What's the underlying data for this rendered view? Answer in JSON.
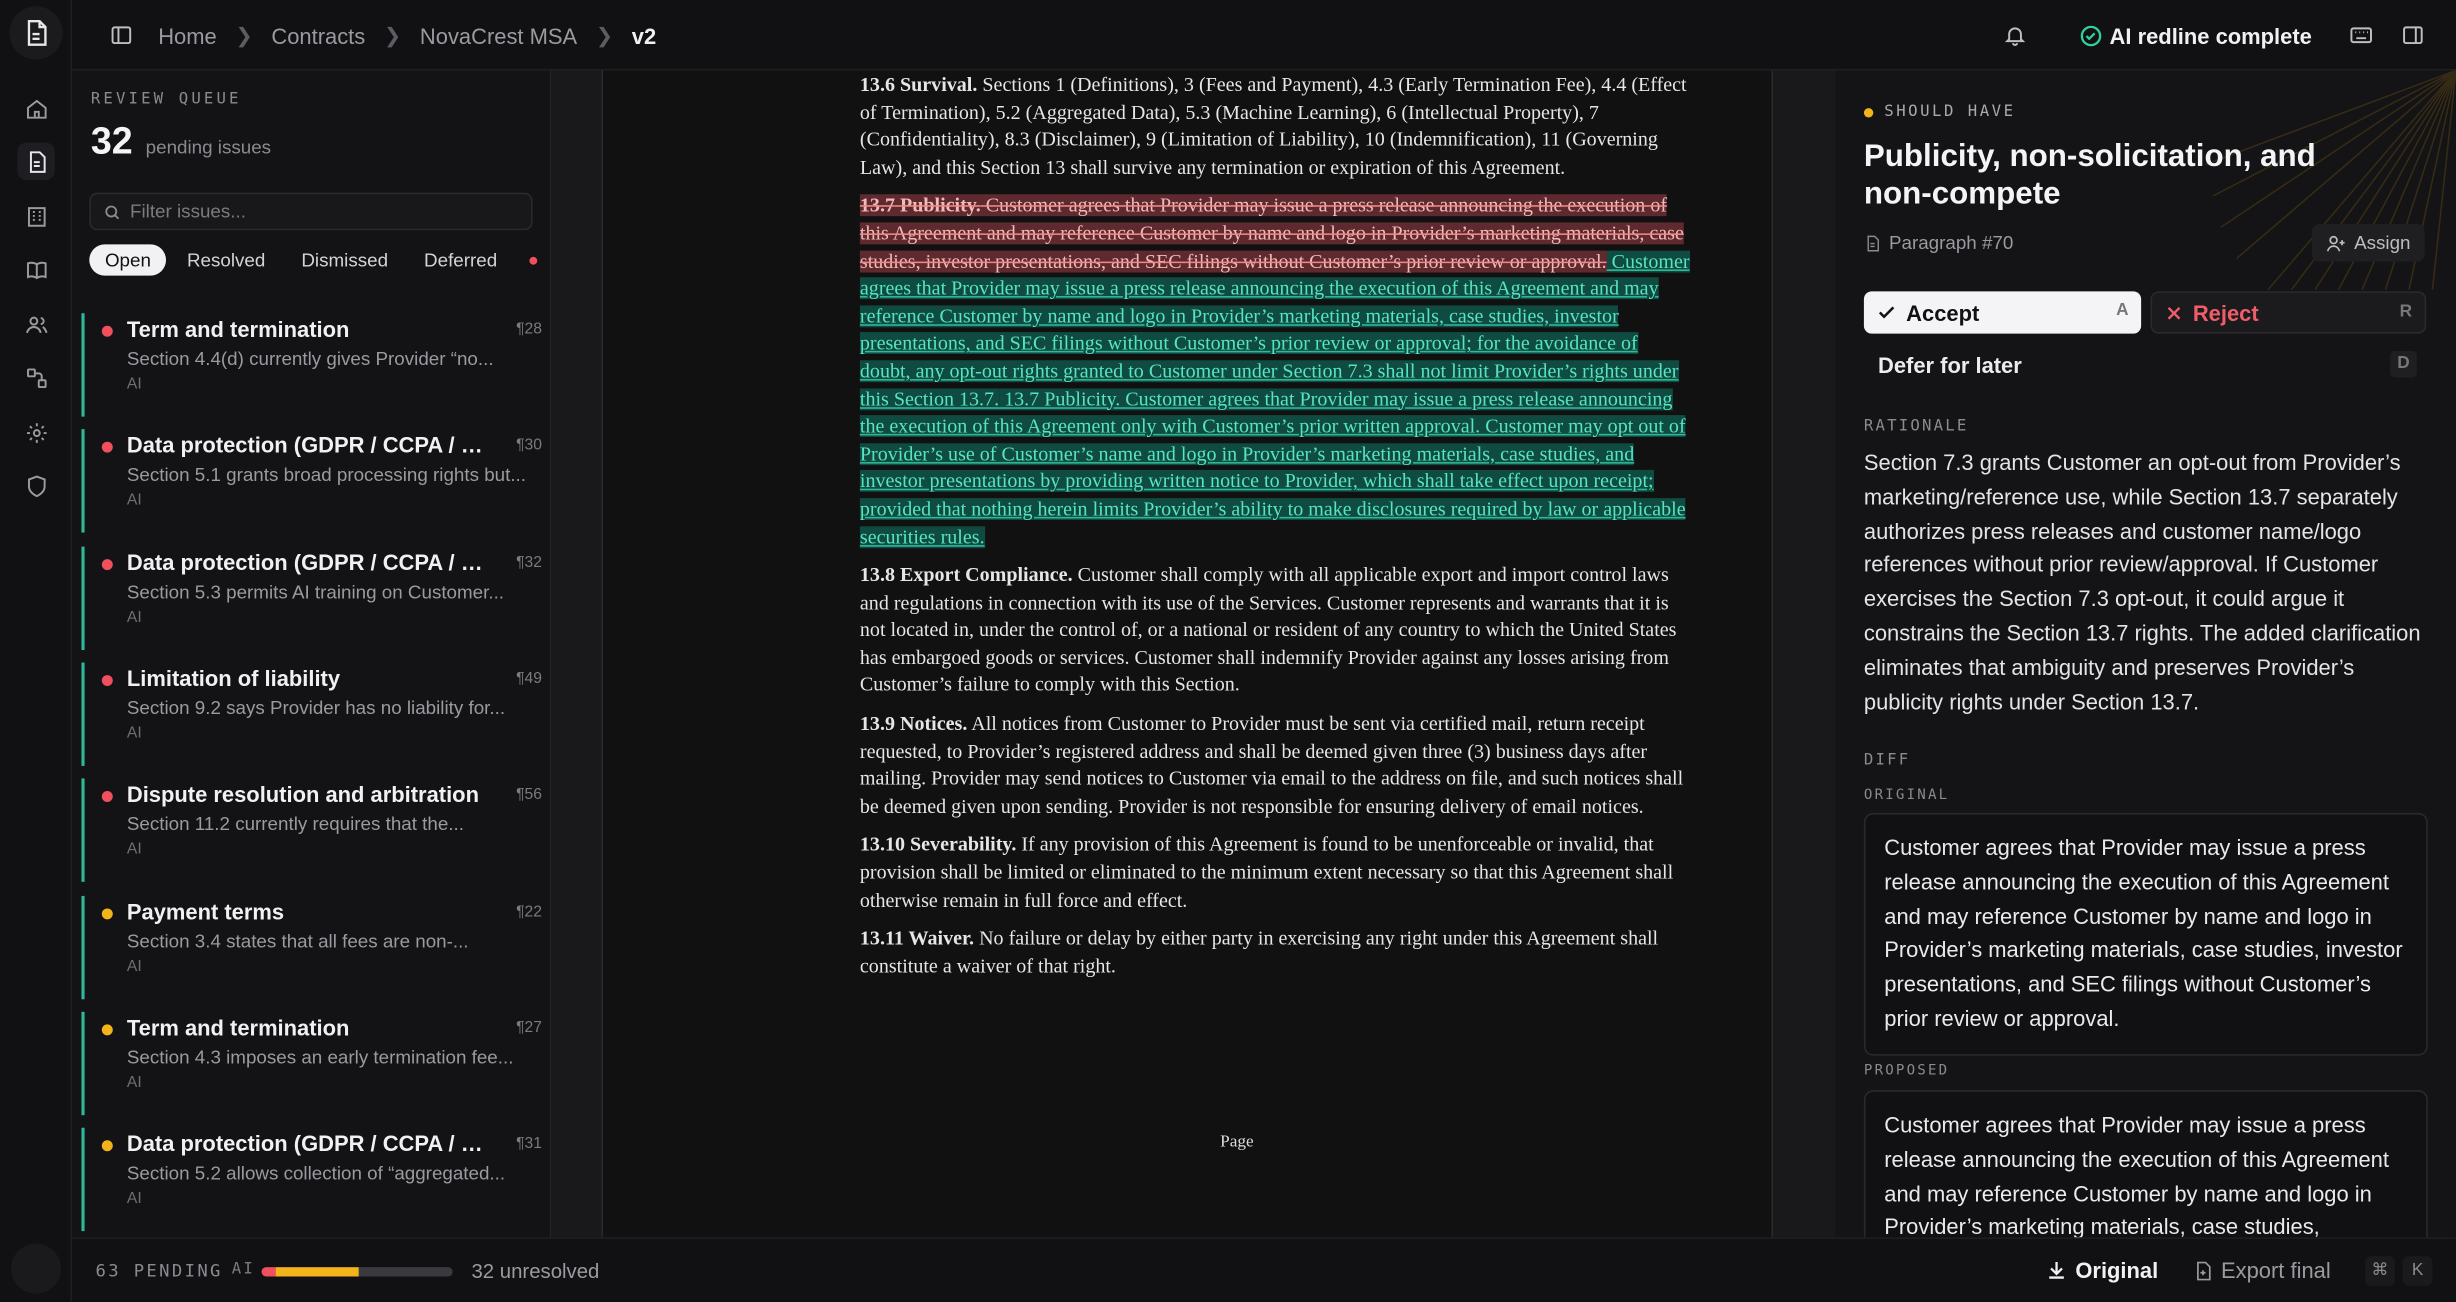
{
  "app": {
    "title": "NovaCrest MSA"
  },
  "breadcrumb": [
    "Home",
    "Contracts",
    "NovaCrest MSA",
    "v2"
  ],
  "topbar": {
    "status_label": "AI redline complete"
  },
  "review_queue": {
    "label": "REVIEW QUEUE",
    "count": "32",
    "count_label": "pending issues",
    "filter_placeholder": "Filter issues...",
    "tabs": [
      "Open",
      "Resolved",
      "Dismissed",
      "Deferred"
    ],
    "active_tab": "Open",
    "issues": [
      {
        "title": "Term and termination",
        "para": "¶28",
        "desc": "Section 4.4(d) currently gives Provider “no...",
        "tag": "AI",
        "severity": "must"
      },
      {
        "title": "Data protection (GDPR / CCPA / D...",
        "para": "¶30",
        "desc": "Section 5.1 grants broad processing rights but...",
        "tag": "AI",
        "severity": "must"
      },
      {
        "title": "Data protection (GDPR / CCPA / D...",
        "para": "¶32",
        "desc": "Section 5.3 permits AI training on Customer...",
        "tag": "AI",
        "severity": "must"
      },
      {
        "title": "Limitation of liability",
        "para": "¶49",
        "desc": "Section 9.2 says Provider has no liability for...",
        "tag": "AI",
        "severity": "must"
      },
      {
        "title": "Dispute resolution and arbitration",
        "para": "¶56",
        "desc": "Section 11.2 currently requires that the...",
        "tag": "AI",
        "severity": "must"
      },
      {
        "title": "Payment terms",
        "para": "¶22",
        "desc": "Section 3.4 states that all fees are non-...",
        "tag": "AI",
        "severity": "should"
      },
      {
        "title": "Term and termination",
        "para": "¶27",
        "desc": "Section 4.3 imposes an early termination fee...",
        "tag": "AI",
        "severity": "should"
      },
      {
        "title": "Data protection (GDPR / CCPA / D...",
        "para": "¶31",
        "desc": "Section 5.2 allows collection of “aggregated...",
        "tag": "AI",
        "severity": "should"
      }
    ]
  },
  "document": {
    "survival_head": "13.6 Survival.",
    "survival_body": " Sections 1 (Definitions), 3 (Fees and Payment), 4.3 (Early Termination Fee), 4.4 (Effect of Termination), 5.2 (Aggregated Data), 5.3 (Machine Learning), 6 (Intellectual Property), 7 (Confidentiality), 8.3 (Disclaimer), 9 (Limitation of Liability), 10 (Indemnification), 11 (Governing Law), and this Section 13 shall survive any termination or expiration of this Agreement.",
    "publicity_head": "13.7 Publicity.",
    "publicity_deleted": " Customer agrees that Provider may issue a press release announcing the execution of this Agreement and may reference Customer by name and logo in Provider’s marketing materials, case studies, investor presentations, and SEC filings without Customer’s prior review or approval.",
    "publicity_inserted_1": " Customer agrees that Provider may issue a press release announcing the execution of this Agreement and may reference Customer by name and logo in Provider’s marketing materials, case studies, investor presentations, and SEC filings without Customer’s prior review or approval; for the avoidance of doubt, any opt-out rights granted to Customer under Section 7.3 shall not limit Provider’s rights under this Section 13.7.",
    "publicity_inserted_2": " 13.7 Publicity. Customer agrees that Provider may issue a press release announcing the execution of this Agreement only with Customer’s prior written approval. Customer may opt out of Provider’s use of Customer’s name and logo in Provider’s marketing materials, case studies, and investor presentations by providing written notice to Provider, which shall take effect upon receipt; provided that nothing herein limits Provider’s ability to make disclosures required by law or applicable securities rules.",
    "export_head": "13.8 Export Compliance.",
    "export_body": " Customer shall comply with all applicable export and import control laws and regulations in connection with its use of the Services. Customer represents and warrants that it is not located in, under the control of, or a national or resident of any country to which the United States has embargoed goods or services. Customer shall indemnify Provider against any losses arising from Customer’s failure to comply with this Section.",
    "notices_head": "13.9 Notices.",
    "notices_body": " All notices from Customer to Provider must be sent via certified mail, return receipt requested, to Provider’s registered address and shall be deemed given three (3) business days after mailing. Provider may send notices to Customer via email to the address on file, and such notices shall be deemed given upon sending. Provider is not responsible for ensuring delivery of email notices.",
    "sever_head": "13.10 Severability.",
    "sever_body": " If any provision of this Agreement is found to be unenforceable or invalid, that provision shall be limited or eliminated to the minimum extent necessary so that this Agreement shall otherwise remain in full force and effect.",
    "waiver_head": "13.11 Waiver.",
    "waiver_body": " No failure or delay by either party in exercising any right under this Agreement shall constitute a waiver of that right.",
    "page_label": "Page"
  },
  "detail": {
    "priority_label": "SHOULD HAVE",
    "title": "Publicity, non-solicitation, and non-compete",
    "paragraph_ref": "Paragraph #70",
    "assign_label": "Assign",
    "accept_label": "Accept",
    "accept_key": "A",
    "reject_label": "Reject",
    "reject_key": "R",
    "defer_label": "Defer for later",
    "defer_key": "D",
    "rationale_label": "RATIONALE",
    "rationale": "Section 7.3 grants Customer an opt-out from Provider’s marketing/reference use, while Section 13.7 separately authorizes press releases and customer name/logo references without prior review/approval. If Customer exercises the Section 7.3 opt-out, it could argue it constrains the Section 13.7 rights. The added clarification eliminates that ambiguity and preserves Provider’s publicity rights under Section 13.7.",
    "diff_label": "DIFF",
    "original_label": "ORIGINAL",
    "original_text": "Customer agrees that Provider may issue a press release announcing the execution of this Agreement and may reference Customer by name and logo in Provider’s marketing materials, case studies, investor presentations, and SEC filings without Customer’s prior review or approval.",
    "proposed_label": "PROPOSED",
    "proposed_text": "Customer agrees that Provider may issue a press release announcing the execution of this Agreement and may reference Customer by name and logo in Provider’s marketing materials, case studies,"
  },
  "footer": {
    "pending_label": "63 PENDING",
    "ai_label": "AI",
    "progress": {
      "must": 0.07,
      "should": 0.44,
      "rest": 0.49
    },
    "unresolved_label": "32 unresolved",
    "original_label": "Original",
    "export_label": "Export final",
    "shortcut_cmd": "⌘",
    "shortcut_key": "K"
  },
  "colors": {
    "must": "#f0505d",
    "should": "#f3b41b",
    "accent": "#2fb89a",
    "insert": "#57e5c1",
    "delete": "#f4b9b9"
  }
}
